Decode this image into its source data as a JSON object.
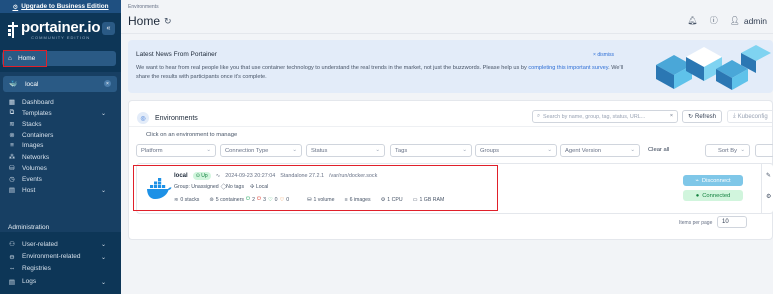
{
  "sidebar": {
    "upgrade_label": "Upgrade to Business Edition",
    "brand_name": "portainer.io",
    "brand_edition": "COMMUNITY EDITION",
    "home_label": "Home",
    "env_name": "local",
    "items": [
      {
        "label": "Dashboard",
        "icon": "dashboard-icon"
      },
      {
        "label": "Templates",
        "icon": "templates-icon",
        "chevron": true
      },
      {
        "label": "Stacks",
        "icon": "stacks-icon"
      },
      {
        "label": "Containers",
        "icon": "containers-icon"
      },
      {
        "label": "Images",
        "icon": "images-icon"
      },
      {
        "label": "Networks",
        "icon": "networks-icon"
      },
      {
        "label": "Volumes",
        "icon": "volumes-icon"
      },
      {
        "label": "Events",
        "icon": "events-icon"
      },
      {
        "label": "Host",
        "icon": "host-icon",
        "chevron": true
      }
    ],
    "admin_label": "Administration",
    "admin_items": [
      {
        "label": "User-related",
        "chevron": true
      },
      {
        "label": "Environment-related",
        "chevron": true
      },
      {
        "label": "Registries",
        "chevron": false
      },
      {
        "label": "Logs",
        "chevron": true
      }
    ]
  },
  "header": {
    "breadcrumb": "Environments",
    "title": "Home",
    "user": "admin"
  },
  "news": {
    "heading": "Latest News From Portainer",
    "dismiss": "dismiss",
    "text_before": "We want to hear from real people like you that use container technology to understand the real trends in the market, not just the buzzwords. Please help us by ",
    "link": "completing this important survey",
    "text_after": ". We'll share the results with participants once it's complete."
  },
  "environments": {
    "title": "Environments",
    "search_placeholder": "Search by name, group, tag, status, URL...",
    "refresh_label": "Refresh",
    "kube_label": "Kubeconfig",
    "hint": "Click on an environment to manage",
    "filters": [
      "Platform",
      "Connection Type",
      "Status",
      "Tags",
      "Groups",
      "Agent Version"
    ],
    "clear_all": "Clear all",
    "sort_label": "Sort By",
    "items_per_page_label": "Items per page",
    "items_per_page": "10",
    "item": {
      "name": "local",
      "status": "Up",
      "timestamp": "2024-09-23 20:27:04",
      "type": "Standalone 27.2.1",
      "socket": "/var/run/docker.sock",
      "group": "Group: Unassigned",
      "tags": "No tags",
      "location": "Local",
      "stacks": "0 stacks",
      "containers": "5 containers",
      "running": "2",
      "stopped": "3",
      "healthy": "0",
      "unhealthy": "0",
      "volumes": "1 volume",
      "images": "6 images",
      "cpu": "1 CPU",
      "ram": "1 GB RAM",
      "disconnect_label": "Disconnect",
      "connected_label": "Connected"
    }
  },
  "colors": {
    "sidebar_bg": "#0d3657",
    "accent": "#2f6fd6",
    "highlight": "#e0202a",
    "success": "#13a454"
  }
}
